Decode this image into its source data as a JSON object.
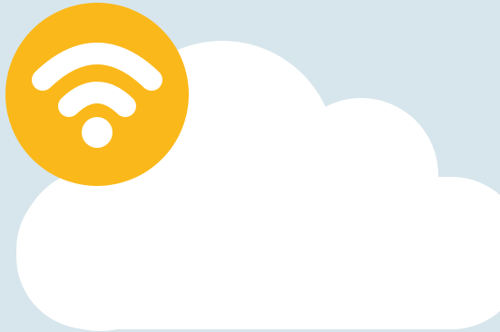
{
  "illustration": {
    "subject": "cloud-wifi",
    "icons": [
      "cloud-icon",
      "wifi-icon"
    ],
    "colors": {
      "background": "#d7e6ec",
      "cloud": "#ffffff",
      "badge": "#fbb81a",
      "wifi_symbol": "#ffffff"
    }
  }
}
